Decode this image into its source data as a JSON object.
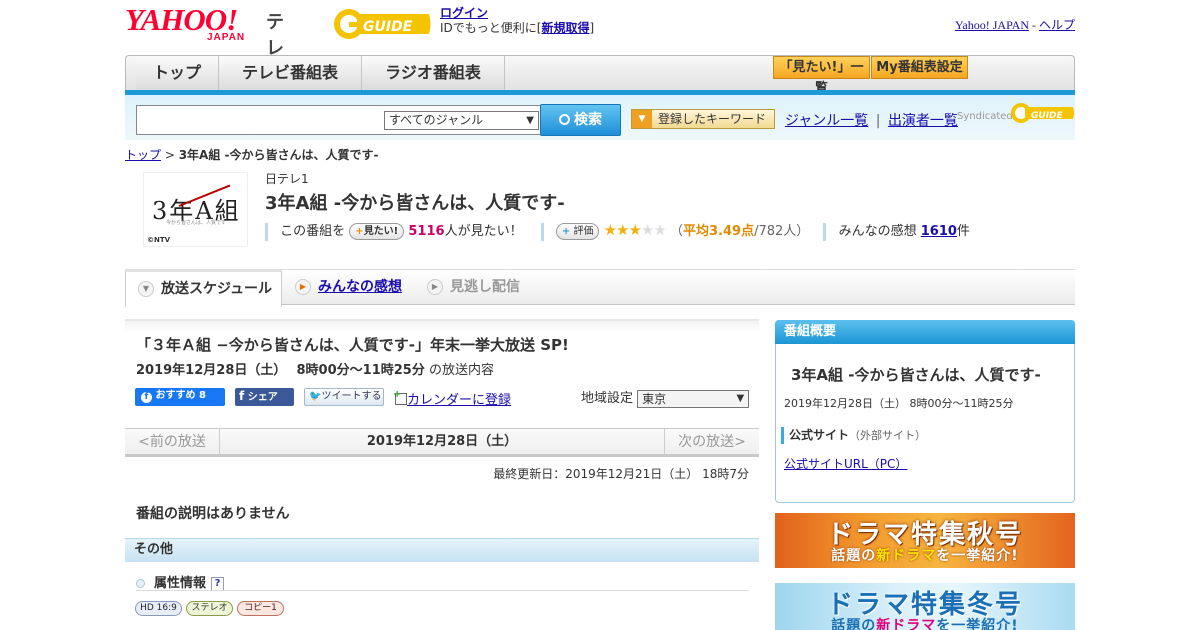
{
  "header": {
    "yahoo_logo": "YAHOO!",
    "japan_logo": "JAPAN",
    "tv_label": "テレビ",
    "gguide_logo": "G-GUIDE",
    "login_link": "ログイン",
    "login_text_prefix": "IDでもっと便利に[",
    "register_link": "新規取得",
    "login_text_suffix": "]",
    "yahoo_japan_link": "Yahoo! JAPAN",
    "separator": " - ",
    "help_link": "ヘルプ"
  },
  "nav": {
    "tabs": [
      "トップ",
      "テレビ番組表",
      "ラジオ番組表"
    ],
    "want_list_button": "「見たい!」一覧",
    "my_schedule_button": "My番組表設定"
  },
  "search": {
    "genre_selected": "すべてのジャンル",
    "search_button": "検索",
    "keyword_button": "登録したキーワード",
    "genre_list_link": "ジャンル一覧",
    "link_separator": "|",
    "performer_list_link": "出演者一覧",
    "syndicated_label": "Syndicated",
    "syndicated_logo": "G-GUIDE"
  },
  "breadcrumb": {
    "top_link": "トップ",
    "separator": " > ",
    "current": "3年A組 -今から皆さんは、人質です-"
  },
  "program": {
    "thumb_title": "3年A組",
    "thumb_sub": "今から皆さんは、人質です",
    "thumb_credit": "©NTV",
    "channel": "日テレ1",
    "title": "3年A組 -今から皆さんは、人質です-",
    "want_prefix": "この番組を",
    "want_button": "見たい!",
    "want_count": "5116",
    "want_suffix": "人が見たい！",
    "rate_button": "評価",
    "rating": 3,
    "rating_max": 5,
    "avg_prefix": "（",
    "avg_label": "平均3.49点",
    "avg_count": "/782人）",
    "impressions_prefix": "みんなの感想",
    "impressions_count": "1610",
    "impressions_suffix": "件"
  },
  "tabs": {
    "schedule": "放送スケジュール",
    "impressions": "みんなの感想",
    "streaming": "見逃し配信"
  },
  "episode": {
    "title": "「３年Ａ組 −今から皆さんは、人質です-」年末一挙大放送 SP!",
    "date": "2019年12月28日（土）",
    "time": "8時00分～11時25分",
    "date_suffix": "の放送内容",
    "fb_like": "おすすめ 8",
    "fb_share": "シェア",
    "tweet": "ツイートする",
    "calendar": "カレンダーに登録",
    "region_label": "地域設定",
    "region_selected": "東京"
  },
  "date_nav": {
    "prev": "<前の放送",
    "current": "2019年12月28日（土）",
    "next": "次の放送>"
  },
  "updated": "最終更新日：2019年12月21日（土） 18時7分",
  "no_description": "番組の説明はありません",
  "other": {
    "heading": "その他",
    "attr_label": "属性情報",
    "help_mark": "?",
    "tags": [
      "HD 16:9",
      "ステレオ",
      "コピー1"
    ]
  },
  "sidebar": {
    "heading": "番組概要",
    "title": "3年A組 -今から皆さんは、人質です-",
    "time": "2019年12月28日（土） 8時00分～11時25分",
    "official_label": "公式サイト",
    "official_note": "（外部サイト）",
    "official_link": "公式サイトURL（PC）"
  },
  "banners": {
    "autumn_big": "ドラマ特集秋号",
    "autumn_small_pre": "話題の",
    "autumn_small_hl": "新ドラマ",
    "autumn_small_post": "を一挙紹介!",
    "winter_big": "ドラマ特集冬号",
    "winter_small_pre": "話題の",
    "winter_small_hl": "新ドラマ",
    "winter_small_post": "を一挙紹介!"
  },
  "colors": {
    "accent_blue": "#1b9ad6",
    "brand_red": "#ff0033",
    "want_count_color": "#cc0066",
    "rating_color": "#e08a00"
  }
}
